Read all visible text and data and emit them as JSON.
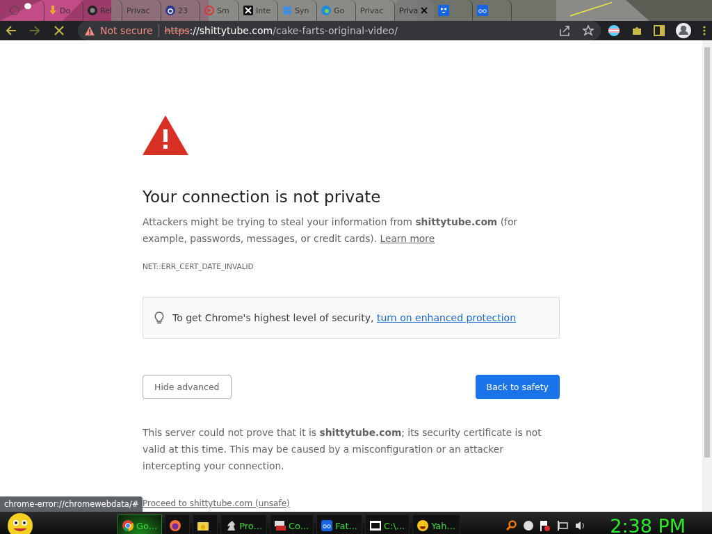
{
  "tabs": [
    {
      "kind": "plain",
      "selected": false
    },
    {
      "kind": "download",
      "label": "Do",
      "selected": false
    },
    {
      "kind": "github",
      "label": "Rel",
      "selected": false
    },
    {
      "kind": "none",
      "label": "Privac",
      "selected": false
    },
    {
      "kind": "ring",
      "label": "23",
      "selected": false
    },
    {
      "kind": "target",
      "label": "Sm",
      "selected": false
    },
    {
      "kind": "x",
      "label": "Inte",
      "selected": false
    },
    {
      "kind": "flower",
      "label": "Syn",
      "selected": false
    },
    {
      "kind": "edge",
      "label": "Go",
      "selected": false
    },
    {
      "kind": "none",
      "label": "Privac",
      "selected": false
    },
    {
      "kind": "none",
      "label": "Priva",
      "selected": true
    },
    {
      "kind": "dropbox",
      "selected": false
    },
    {
      "kind": "box",
      "selected": false
    }
  ],
  "toolbar": {
    "security_label": "Not secure",
    "url_scheme": "https",
    "url_host": "://shittytube.com",
    "url_path": "/cake-farts-original-video/",
    "loading": true
  },
  "page": {
    "heading": "Your connection is not private",
    "message": "Attackers might be trying to steal your information from **shittytube.com** (for example, passwords, messages, or credit cards).",
    "learn_more": "Learn more",
    "error_code": "NET::ERR_CERT_DATE_INVALID",
    "tip_text": "To get Chrome's highest level of security,",
    "tip_link": "turn on enhanced protection",
    "secondary_button": "Hide advanced",
    "primary_button": "Back to safety",
    "details": "This server could not prove that it is **shittytube.com**; its security certificate is not valid at this time. This may be caused by a misconfiguration or an attacker intercepting your connection.",
    "proceed_link": "Proceed to shittytube.com (unsafe)"
  },
  "status_bubble": "chrome-error://chromewebdata/#",
  "taskbar": {
    "items": [
      {
        "kind": "chrome",
        "label": "Go...",
        "active": true
      },
      {
        "kind": "firefox",
        "active": false
      },
      {
        "kind": "folder",
        "active": false
      },
      {
        "kind": "horse",
        "label": "Pro...",
        "active": false
      },
      {
        "kind": "toolbox",
        "label": "Co...",
        "active": false
      },
      {
        "kind": "box",
        "label": "Fat...",
        "active": false
      },
      {
        "kind": "zip",
        "label": "C:\\...",
        "active": false
      },
      {
        "kind": "smiley",
        "label": "Yah...",
        "active": false
      }
    ],
    "clock": "2:38 PM"
  }
}
